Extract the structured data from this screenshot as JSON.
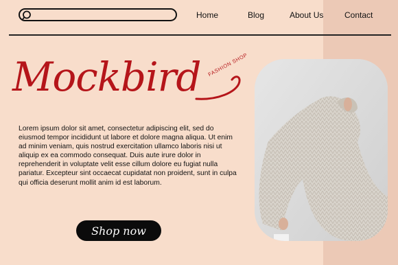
{
  "search": {
    "placeholder": ""
  },
  "nav": {
    "items": [
      "Home",
      "Blog",
      "About Us",
      "Contact"
    ]
  },
  "brand": {
    "name": "Mockbird",
    "tagline": "FASHION SHOP"
  },
  "description": "Lorem ipsum dolor sit amet, consectetur adipiscing elit, sed do eiusmod tempor incididunt ut labore et dolore magna aliqua. Ut enim ad minim veniam, quis nostrud exercitation ullamco laboris nisi ut aliquip ex ea commodo consequat. Duis aute irure dolor in reprehenderit in voluptate velit esse cillum dolore eu fugiat nulla pariatur. Excepteur sint occaecat cupidatat non proident, sunt in culpa qui officia deserunt mollit anim id est laborum.",
  "cta": {
    "label": "Shop now"
  },
  "colors": {
    "background": "#f8ddcb",
    "accent_panel": "#ecc9b6",
    "brand_red": "#b5151a",
    "button": "#0b0b0b"
  },
  "icons": {
    "search": "search-icon"
  }
}
